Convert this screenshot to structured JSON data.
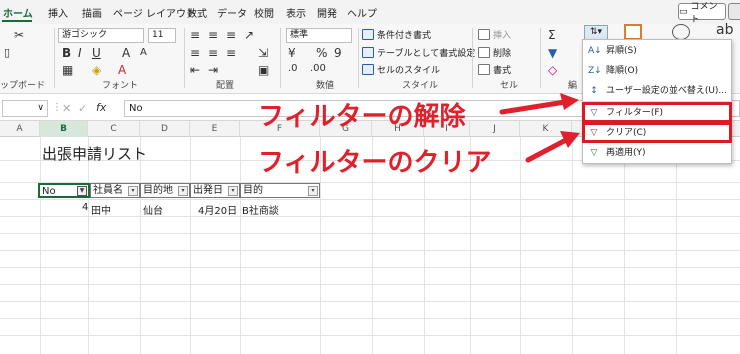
{
  "tabs": [
    "ホーム",
    "挿入",
    "描画",
    "ページ レイアウト",
    "数式",
    "データ",
    "校閲",
    "表示",
    "開発",
    "ヘルプ"
  ],
  "comment_label": "コメント",
  "ribbon": {
    "clipboard_label": "ップボード",
    "font_name": "游ゴシック",
    "font_size": "11",
    "font_label": "フォント",
    "align_label": "配置",
    "number_format": "標準",
    "number_label": "数値",
    "cond_format": "条件付き書式",
    "table_format": "テーブルとして書式設定",
    "cell_style": "セルのスタイル",
    "style_label": "スタイル",
    "insert": "挿入",
    "delete": "削除",
    "format": "書式",
    "cells_label": "セル",
    "edit_label": "編"
  },
  "formula_bar": {
    "fx": "fx",
    "value": "No"
  },
  "columns": [
    "A",
    "B",
    "C",
    "D",
    "E",
    "F",
    "G",
    "H",
    "I",
    "J",
    "K"
  ],
  "sheet": {
    "title": "出張申請リスト",
    "headers": [
      "No",
      "社員名",
      "目的地",
      "出発日",
      "目的"
    ],
    "row": [
      "4",
      "田中",
      "仙台",
      "4月20日",
      "B社商談"
    ]
  },
  "menu": {
    "items": [
      {
        "label": "昇順(S)",
        "icon": "A↓"
      },
      {
        "label": "降順(O)",
        "icon": "Z↓"
      },
      {
        "label": "ユーザー設定の並べ替え(U)...",
        "icon": "↕"
      },
      {
        "label": "フィルター(F)",
        "icon": "▽"
      },
      {
        "label": "クリア(C)",
        "icon": "▽"
      },
      {
        "label": "再適用(Y)",
        "icon": "▽"
      }
    ]
  },
  "annotations": {
    "remove_filter": "フィルターの解除",
    "clear_filter": "フィルターのクリア"
  },
  "colors": {
    "accent": "#1a6b3c",
    "highlight": "#d91b26",
    "annotation": "#e0202c"
  }
}
